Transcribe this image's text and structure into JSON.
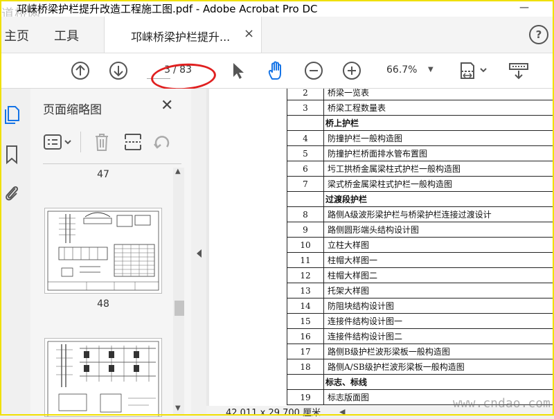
{
  "window": {
    "title": "邛崃桥梁护栏提升改造工程施工图.pdf - Adobe Acrobat Pro DC",
    "watermark_logo": "道桥网",
    "minimize": "—"
  },
  "tabs": {
    "home": "主页",
    "tools": "工具",
    "document_tab": "邛崃桥梁护栏提升...",
    "close": "×",
    "help": "?"
  },
  "toolbar": {
    "current_page": "3",
    "total_pages": "/ 83",
    "zoom": "66.7%"
  },
  "thumbnail_panel": {
    "title": "页面缩略图",
    "close": "✕",
    "pages": [
      "47",
      "48"
    ]
  },
  "document": {
    "rows": [
      {
        "num": "2",
        "text": "桥梁一览表",
        "section": false
      },
      {
        "num": "3",
        "text": "桥梁工程数量表",
        "section": false
      },
      {
        "num": "",
        "text": "桥上护栏",
        "section": true
      },
      {
        "num": "4",
        "text": "防撞护栏一般构造图",
        "section": false
      },
      {
        "num": "5",
        "text": "防撞护栏桥面排水管布置图",
        "section": false
      },
      {
        "num": "6",
        "text": "圬工拱桥金属梁柱式护栏一般构造图",
        "section": false
      },
      {
        "num": "7",
        "text": "梁式桥金属梁柱式护栏一般构造图",
        "section": false
      },
      {
        "num": "",
        "text": "过渡段护栏",
        "section": true
      },
      {
        "num": "8",
        "text": "路侧A级波形梁护栏与桥梁护栏连接过渡设计",
        "section": false
      },
      {
        "num": "9",
        "text": "路侧圆形端头结构设计图",
        "section": false
      },
      {
        "num": "10",
        "text": "立柱大样图",
        "section": false
      },
      {
        "num": "11",
        "text": "柱帽大样图一",
        "section": false
      },
      {
        "num": "12",
        "text": "柱帽大样图二",
        "section": false
      },
      {
        "num": "13",
        "text": "托架大样图",
        "section": false
      },
      {
        "num": "14",
        "text": "防阻块结构设计图",
        "section": false
      },
      {
        "num": "15",
        "text": "连接件结构设计图一",
        "section": false
      },
      {
        "num": "16",
        "text": "连接件结构设计图二",
        "section": false
      },
      {
        "num": "17",
        "text": "路侧B级护栏波形梁板一般构造图",
        "section": false
      },
      {
        "num": "18",
        "text": "路侧A/SB级护栏波形梁板一般构造图",
        "section": false
      },
      {
        "num": "",
        "text": "标志、标线",
        "section": true
      },
      {
        "num": "19",
        "text": "标志版面图",
        "section": false
      }
    ]
  },
  "statusbar": {
    "page_size": "42.011 x 29.700 厘米"
  },
  "site_watermark": "www.cndao.com",
  "colors": {
    "annotation": "#e02020",
    "frame": "#f0e000",
    "rail_active": "#1473e6"
  }
}
